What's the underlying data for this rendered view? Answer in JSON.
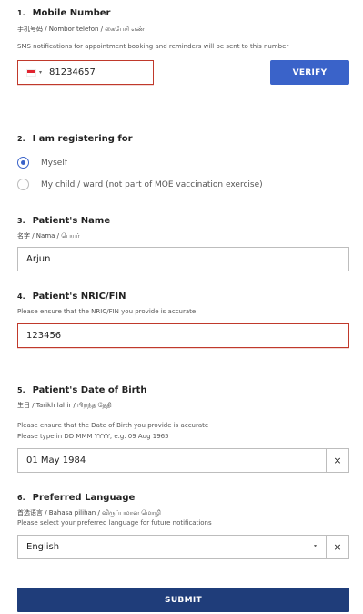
{
  "mobile": {
    "number": "1.",
    "title": "Mobile Number",
    "translations": "手机号码 / Nombor telefon / கைபேசி எண்",
    "note": "SMS notifications for appointment booking and reminders will be sent to this number",
    "value": "81234657",
    "verify_label": "VERIFY"
  },
  "registering": {
    "number": "2.",
    "title": "I am registering for",
    "options": [
      {
        "label": "Myself",
        "checked": true
      },
      {
        "label": "My child / ward (not part of MOE vaccination exercise)",
        "checked": false
      }
    ]
  },
  "name": {
    "number": "3.",
    "title": "Patient's Name",
    "translations": "名字 / Nama / பெயர்",
    "value": "Arjun"
  },
  "nric": {
    "number": "4.",
    "title": "Patient's NRIC/FIN",
    "note": "Please ensure that the NRIC/FIN you provide is accurate",
    "value": "123456"
  },
  "dob": {
    "number": "5.",
    "title": "Patient's Date of Birth",
    "translations": "生日 / Tarikh lahir / பிறந்த தேதி",
    "note1": "Please ensure that the Date of Birth you provide is accurate",
    "note2": "Please type in DD MMM YYYY, e.g. 09 Aug 1965",
    "value": "01 May 1984",
    "clear": "×"
  },
  "language": {
    "number": "6.",
    "title": "Preferred Language",
    "translations": "首选语言 / Bahasa pilihan / விருப்பமான மொழி",
    "note": "Please select your preferred language for future notifications",
    "value": "English",
    "clear": "×"
  },
  "submit_label": "SUBMIT",
  "colors": {
    "accent": "#3a63c9",
    "submit": "#1f3d7a",
    "error": "#c0392b"
  }
}
